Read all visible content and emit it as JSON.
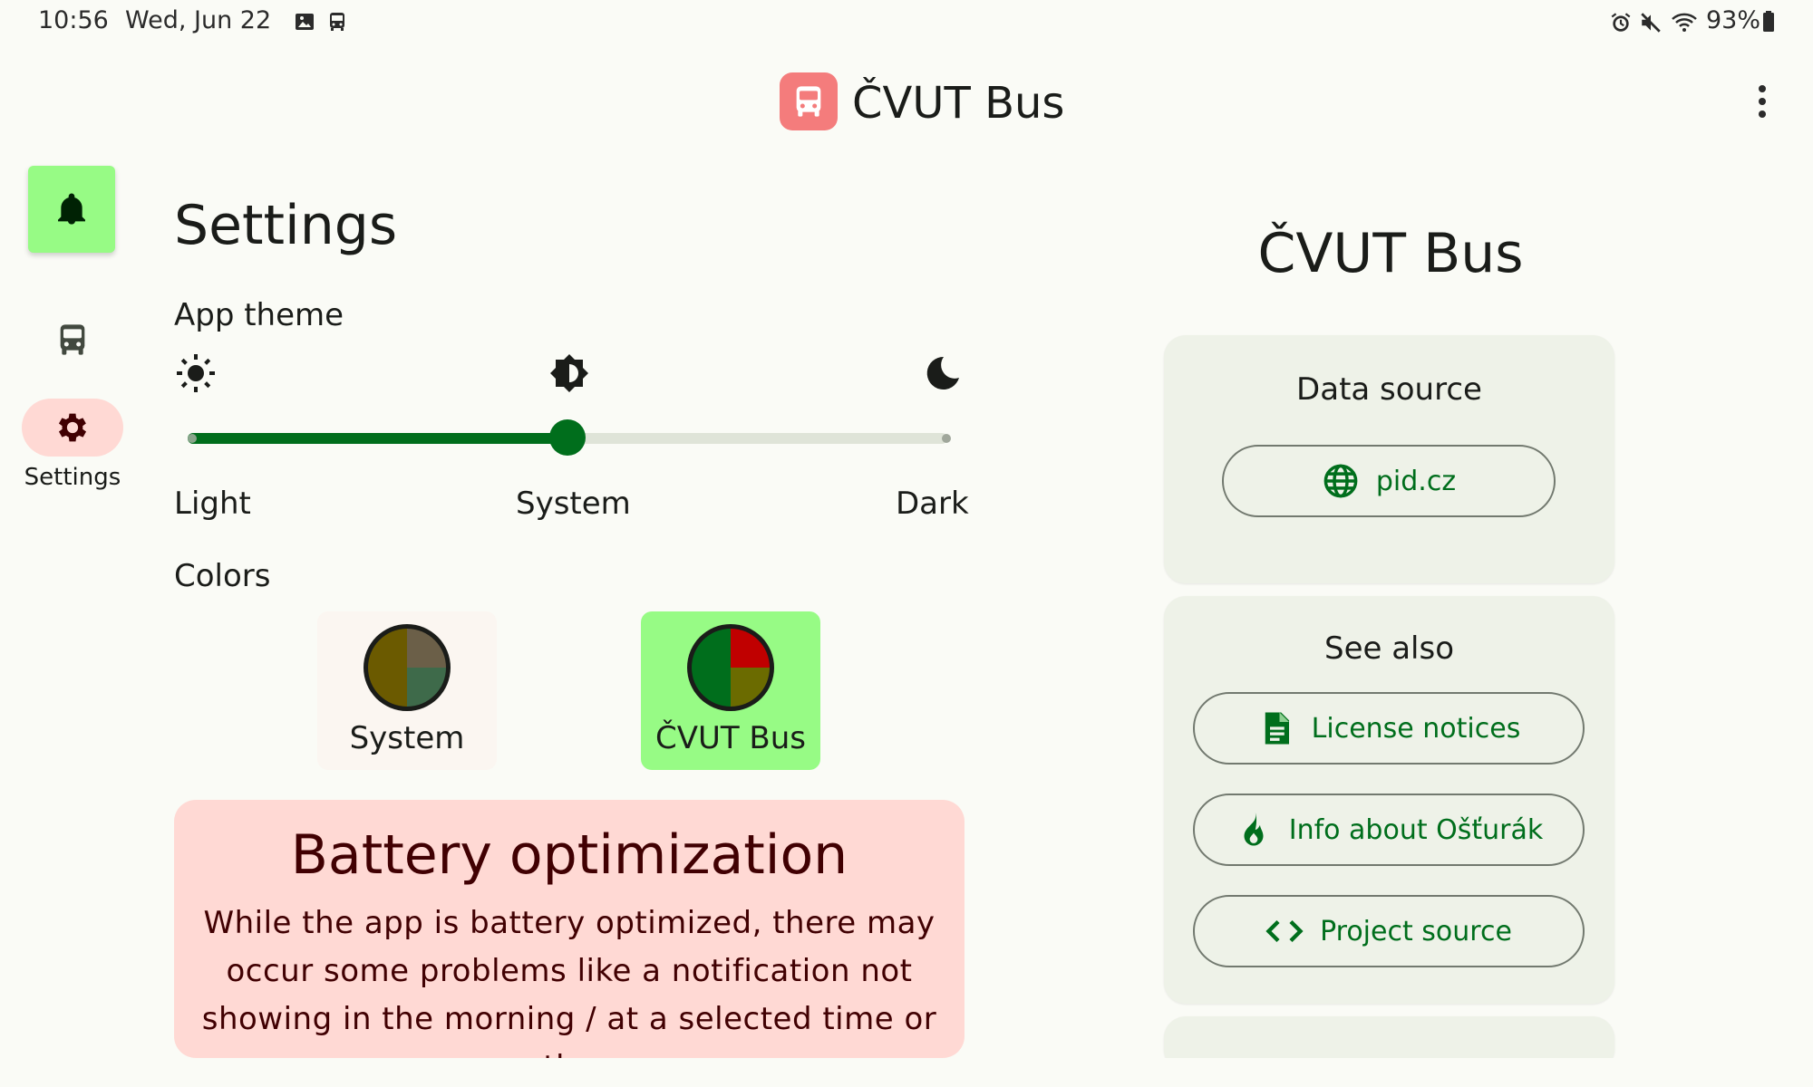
{
  "status_bar": {
    "time": "10:56",
    "date": "Wed, Jun 22",
    "battery": "93%",
    "icons": [
      "image-notification-icon",
      "bus-notification-icon",
      "alarm-icon",
      "mute-icon",
      "wifi-icon",
      "battery-icon"
    ]
  },
  "app_bar": {
    "title": "ČVUT Bus",
    "logo_icon": "bus-icon",
    "logo_color": "#f47c7c",
    "menu_icon": "more-vert-icon"
  },
  "nav_rail": {
    "fab_icon": "bell-icon",
    "items": [
      {
        "icon": "bus-icon",
        "label": ""
      },
      {
        "icon": "gear-icon",
        "label": "Settings",
        "selected": true
      }
    ]
  },
  "settings": {
    "title": "Settings",
    "app_theme_label": "App theme",
    "theme_slider": {
      "options": [
        "Light",
        "System",
        "Dark"
      ],
      "icons": [
        "sun-icon",
        "brightness-icon",
        "moon-icon"
      ],
      "selected": "System",
      "value": 0.5
    },
    "colors_label": "Colors",
    "color_options": [
      {
        "label": "System",
        "selected": false,
        "swatch": [
          "#6b5a00",
          "#5f5a3e",
          "#3e6a4a",
          "#6b5a00"
        ]
      },
      {
        "label": "ČVUT Bus",
        "selected": true,
        "swatch": [
          "#006e1c",
          "#c00000",
          "#6b6b00",
          "#006e1c"
        ]
      }
    ]
  },
  "battery_card": {
    "title": "Battery optimization",
    "text": "While the app is battery optimized, there may occur some problems like a notification not showing in the morning / at a selected time or the"
  },
  "about": {
    "title": "ČVUT Bus",
    "data_source": {
      "title": "Data source",
      "button": {
        "label": "pid.cz",
        "icon": "globe-icon"
      }
    },
    "see_also": {
      "title": "See also",
      "buttons": [
        {
          "label": "License notices",
          "icon": "document-icon"
        },
        {
          "label": "Info about Ošťurák",
          "icon": "flame-icon"
        },
        {
          "label": "Project source",
          "icon": "code-icon"
        }
      ]
    }
  },
  "colors": {
    "primary": "#006e1c",
    "primary_container": "#97fb85",
    "error_container": "#ffd9d4",
    "surface": "#fafbf6",
    "card": "#eef2e8"
  }
}
